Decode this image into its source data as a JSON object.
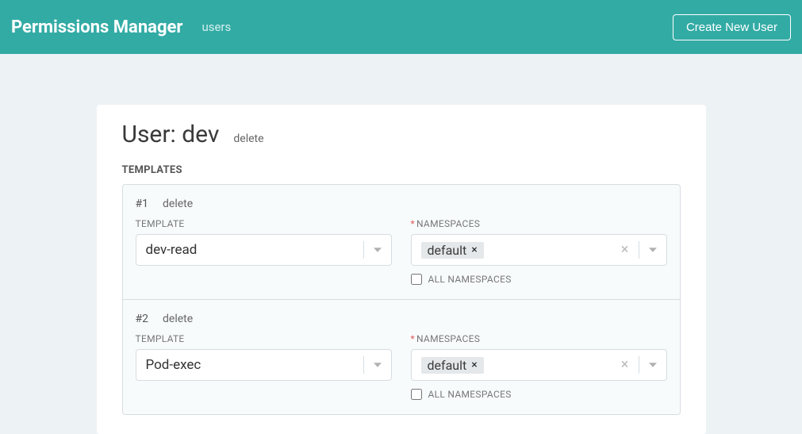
{
  "header": {
    "title": "Permissions Manager",
    "nav_users": "users",
    "create_button": "Create New User"
  },
  "user": {
    "title": "User: dev",
    "delete_label": "delete",
    "templates_heading": "Templates"
  },
  "templates": [
    {
      "number": "#1",
      "delete_label": "delete",
      "template_label": "TEMPLATE",
      "template_value": "dev-read",
      "namespaces_label": "NAMESPACES",
      "namespace_tag": "default",
      "all_ns_label": "ALL NAMESPACES",
      "all_ns_checked": false
    },
    {
      "number": "#2",
      "delete_label": "delete",
      "template_label": "TEMPLATE",
      "template_value": "Pod-exec",
      "namespaces_label": "NAMESPACES",
      "namespace_tag": "default",
      "all_ns_label": "ALL NAMESPACES",
      "all_ns_checked": false
    }
  ]
}
